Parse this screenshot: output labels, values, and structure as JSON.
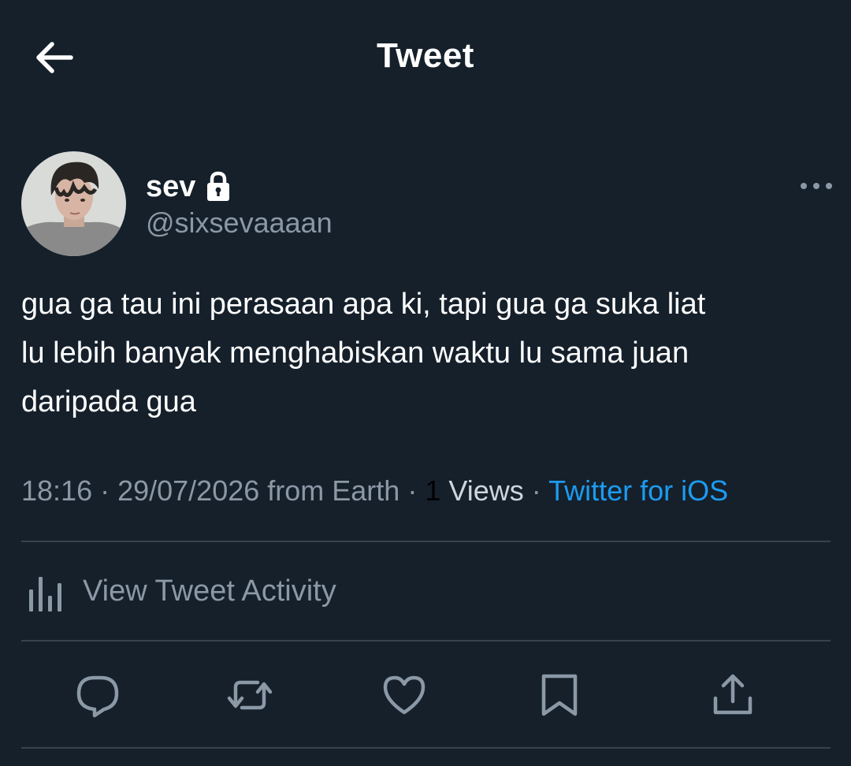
{
  "header": {
    "title": "Tweet"
  },
  "user": {
    "display_name": "sev",
    "handle": "@sixsevaaaan"
  },
  "tweet": {
    "lines": [
      "gua ga tau ini perasaan apa ki, tapi gua ga suka liat",
      "lu lebih banyak menghabiskan waktu lu sama juan",
      "daripada gua"
    ]
  },
  "meta": {
    "time": "18:16",
    "sep1": " · ",
    "date_location": "29/07/2026 from Earth",
    "sep2": " · ",
    "views_count": "1",
    "views_label": " Views",
    "sep3": " · ",
    "source": "Twitter for iOS"
  },
  "activity": {
    "label": "View Tweet Activity"
  },
  "icons": {
    "back": "arrow-left-icon",
    "lock": "lock-icon",
    "more": "more-dots-icon",
    "activity": "bar-chart-icon",
    "reply": "reply-icon",
    "retweet": "retweet-icon",
    "like": "heart-icon",
    "bookmark": "bookmark-icon",
    "share": "share-icon"
  },
  "colors": {
    "background": "#15202b",
    "text": "#ffffff",
    "secondary_text": "#8b98a5",
    "link": "#1d9bf0",
    "divider": "#38444d"
  }
}
